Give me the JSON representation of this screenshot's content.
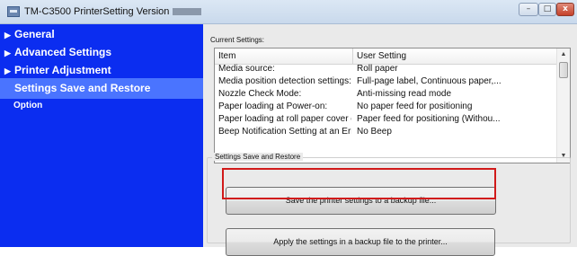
{
  "window": {
    "title": "TM-C3500 PrinterSetting Version",
    "app_icon": "printer-app-icon",
    "controls": {
      "minimize": "–",
      "maximize": "□",
      "close": "x"
    }
  },
  "sidebar": {
    "items": [
      {
        "label": "General",
        "expandable": true
      },
      {
        "label": "Advanced Settings",
        "expandable": true
      },
      {
        "label": "Printer Adjustment",
        "expandable": true
      },
      {
        "label": "Settings Save and Restore",
        "selected": true
      },
      {
        "label": "Option"
      }
    ],
    "caret": "▶"
  },
  "current_settings": {
    "label": "Current Settings:",
    "columns": [
      "Item",
      "User Setting"
    ],
    "rows": [
      [
        "Media source:",
        "Roll paper"
      ],
      [
        "Media position detection settings:",
        "Full-page label, Continuous paper,..."
      ],
      [
        "Nozzle Check Mode:",
        "Anti-missing read mode"
      ],
      [
        "Paper loading at Power-on:",
        "No paper feed for positioning"
      ],
      [
        "Paper loading at roll paper cover cl...",
        "Paper feed for positioning (Withou..."
      ],
      [
        "Beep Notification Setting at an Error:",
        "No Beep"
      ]
    ],
    "scroll_up": "▲",
    "scroll_down": "▼"
  },
  "save_restore": {
    "group_title": "Settings Save and Restore",
    "save_button": "Save the printer settings to a backup file...",
    "apply_button": "Apply the settings in a backup file to the printer...",
    "highlight_color": "#d11a1a"
  },
  "colors": {
    "sidebar_bg": "#0b2df0",
    "sidebar_selected": "#4a74ff",
    "content_bg": "#eaeaea"
  }
}
